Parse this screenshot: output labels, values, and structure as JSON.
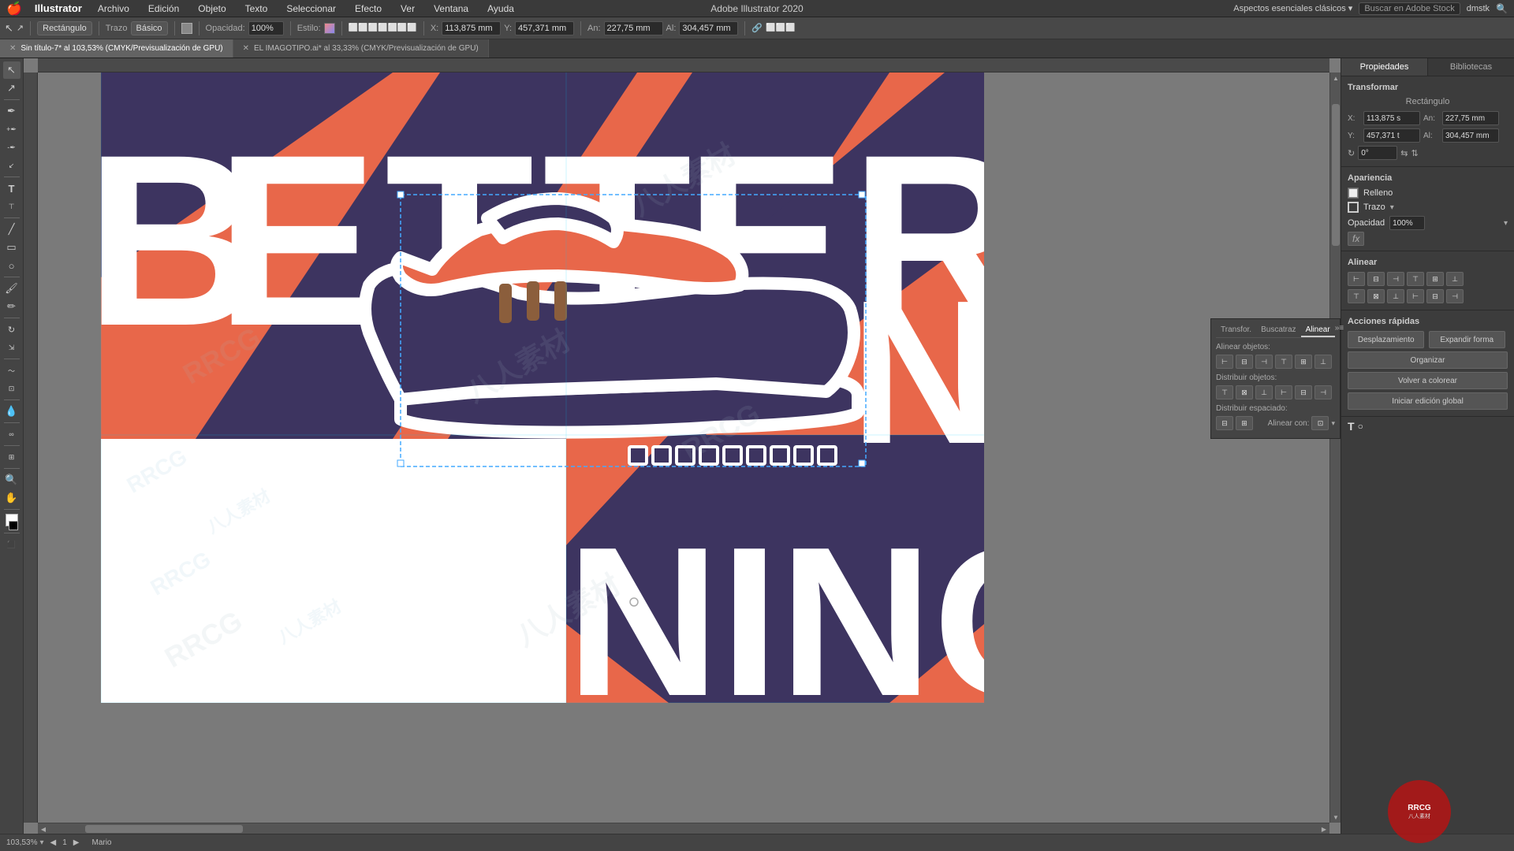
{
  "menubar": {
    "apple": "🍎",
    "app_name": "Illustrator",
    "menus": [
      "Archivo",
      "Edición",
      "Objeto",
      "Texto",
      "Seleccionar",
      "Efecto",
      "Ver",
      "Ventana",
      "Ayuda"
    ],
    "right_items": [
      "dmstk",
      "🔍"
    ],
    "title": "Adobe Illustrator 2020"
  },
  "tabs": [
    {
      "label": "Sin título-7* al 103,53% (CMYK/Previsualización de GPU)",
      "active": true
    },
    {
      "label": "EL IMAGOTIPO.ai* al 33,33% (CMYK/Previsualización de GPU)",
      "active": false
    }
  ],
  "toolbar": {
    "shape_label": "Rectángulo",
    "trazo_label": "Trazo",
    "trazo_style": "Básico",
    "opacity_label": "Opacidad:",
    "opacity_value": "100%",
    "estilo_label": "Estilo:",
    "x_label": "X:",
    "x_value": "113,875 mm",
    "y_label": "Y:",
    "y_value": "457,371 mm",
    "an_label": "An:",
    "an_value": "227,75 mm",
    "al_label": "Al:",
    "al_value": "304,457 mm"
  },
  "right_panel": {
    "tabs": [
      "Propiedades",
      "Bibliotecas"
    ],
    "active_tab": "Propiedades",
    "transform_section": "Transformar",
    "shape_name": "Rectángulo",
    "x_label": "X:",
    "x_val": "113,875 s",
    "an_label": "An:",
    "an_val": "227,75 mm",
    "y_label": "Y:",
    "y_val": "457,371 t",
    "al_label": "Al:",
    "al_val": "304,457 mm",
    "rotate_val": "0°",
    "apariencia_title": "Apariencia",
    "relleno_label": "Relleno",
    "trazo_label": "Trazo",
    "opacidad_label": "Opacidad",
    "opacidad_val": "100%",
    "fx_label": "fx",
    "alinear_title": "Alinear",
    "acciones_title": "Acciones rápidas",
    "desplazamiento_btn": "Desplazamiento",
    "expandir_btn": "Expandir forma",
    "organizar_btn": "Organizar",
    "colorear_btn": "Volver a colorear",
    "edicion_btn": "Iniciar edición global"
  },
  "alinear_panel": {
    "tabs": [
      "Transfor.",
      "Buscatraz",
      "Alinear"
    ],
    "active": "Alinear",
    "alinear_objetos": "Alinear objetos:",
    "distribuir_objetos": "Distribuir objetos:",
    "distribuir_espaciado": "Distribuir espaciado:",
    "alinear_con": "Alinear con:"
  },
  "bottom_bar": {
    "zoom": "103,53%",
    "artboard": "1",
    "user": "Mario",
    "arrows": "◀ ▶"
  },
  "artwork": {
    "text_better": "BETTER",
    "text_n": "N",
    "text_ning": "NING",
    "watermarks": [
      "RRCG",
      "八人素材",
      "RRCG",
      "八人素材"
    ]
  }
}
